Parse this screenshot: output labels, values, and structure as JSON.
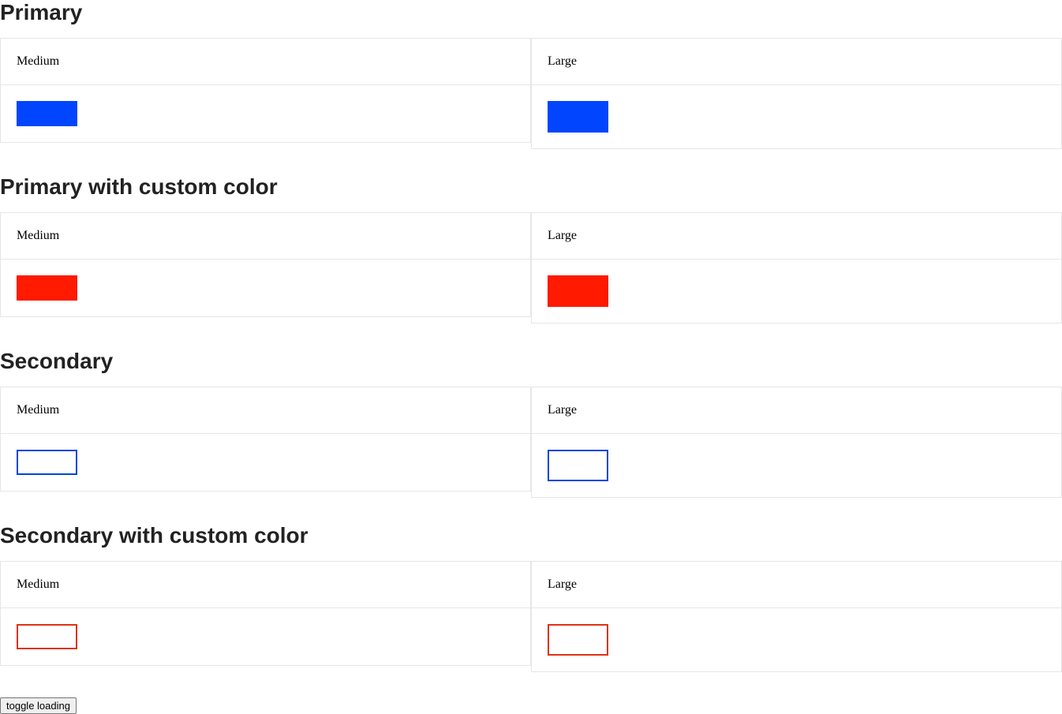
{
  "sections": [
    {
      "title": "Primary",
      "medium_label": "Medium",
      "large_label": "Large",
      "color": "#0145ff",
      "variant": "primary"
    },
    {
      "title": "Primary with custom color",
      "medium_label": "Medium",
      "large_label": "Large",
      "color": "#ff1a00",
      "variant": "primary"
    },
    {
      "title": "Secondary",
      "medium_label": "Medium",
      "large_label": "Large",
      "color": "#0145e0",
      "variant": "secondary"
    },
    {
      "title": "Secondary with custom color",
      "medium_label": "Medium",
      "large_label": "Large",
      "color": "#e03112",
      "variant": "secondary"
    }
  ],
  "toggle": {
    "label": "toggle loading"
  }
}
